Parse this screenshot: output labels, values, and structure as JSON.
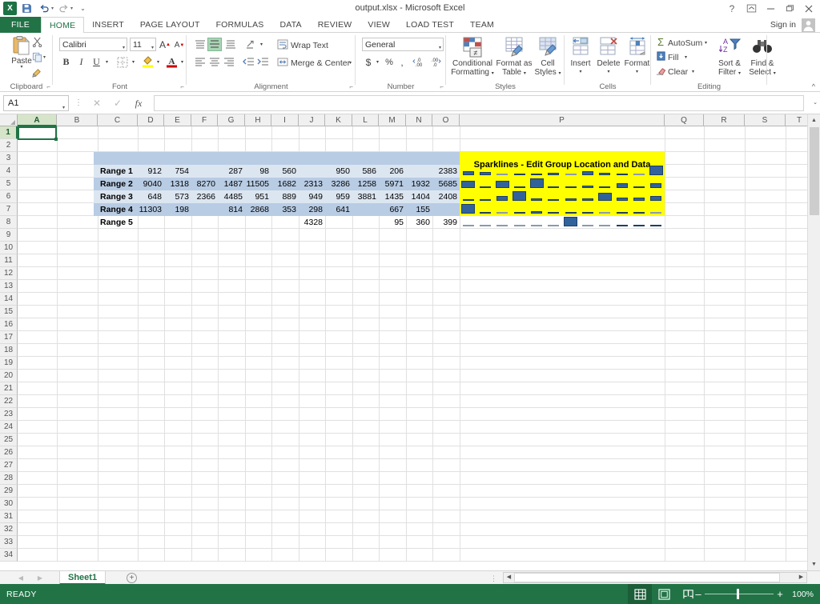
{
  "window": {
    "title": "output.xlsx - Microsoft Excel",
    "help_icon": "?",
    "ribbon_display_icon": "ribbon-options",
    "minimize_icon": "–",
    "restore_icon": "restore",
    "close_icon": "✕",
    "logo_text": "X"
  },
  "quick_access": [
    {
      "name": "save",
      "glyph": "💾"
    },
    {
      "name": "undo",
      "glyph": "↺"
    },
    {
      "name": "redo",
      "glyph": "↻"
    },
    {
      "name": "customize",
      "glyph": "⌄"
    }
  ],
  "tabs": [
    {
      "label": "FILE",
      "active": false,
      "file": true
    },
    {
      "label": "HOME",
      "active": true
    },
    {
      "label": "INSERT",
      "active": false
    },
    {
      "label": "PAGE LAYOUT",
      "active": false
    },
    {
      "label": "FORMULAS",
      "active": false
    },
    {
      "label": "DATA",
      "active": false
    },
    {
      "label": "REVIEW",
      "active": false
    },
    {
      "label": "VIEW",
      "active": false
    },
    {
      "label": "LOAD TEST",
      "active": false
    },
    {
      "label": "TEAM",
      "active": false
    }
  ],
  "account": {
    "signin_label": "Sign in"
  },
  "ribbon": {
    "groups": [
      {
        "name": "clipboard",
        "label": "Clipboard"
      },
      {
        "name": "font",
        "label": "Font"
      },
      {
        "name": "alignment",
        "label": "Alignment"
      },
      {
        "name": "number",
        "label": "Number"
      },
      {
        "name": "styles",
        "label": "Styles"
      },
      {
        "name": "cells",
        "label": "Cells"
      },
      {
        "name": "editing",
        "label": "Editing"
      }
    ],
    "clipboard": {
      "paste_label": "Paste",
      "cut": "Cut",
      "copy": "Copy",
      "format_painter": "Format Painter"
    },
    "font": {
      "font_name": "Calibri",
      "font_size": "11",
      "grow_font": "A",
      "shrink_font": "A",
      "bold": "B",
      "italic": "I",
      "underline": "U",
      "borders": "Borders",
      "fill_color": "Fill Color",
      "font_color": "Font Color"
    },
    "alignment": {
      "wrap_text": "Wrap Text",
      "merge_center": "Merge & Center",
      "orientation": "Orientation",
      "decrease_indent": "Decrease Indent",
      "increase_indent": "Increase Indent"
    },
    "number": {
      "format": "General",
      "accounting": "$",
      "percent": "%",
      "comma": ",",
      "increase_decimal": "Increase Decimal",
      "decrease_decimal": "Decrease Decimal"
    },
    "styles": {
      "conditional_formatting": "Conditional\nFormatting",
      "conditional_formatting_l1": "Conditional",
      "conditional_formatting_l2": "Formatting",
      "format_as_table_l1": "Format as",
      "format_as_table_l2": "Table",
      "cell_styles_l1": "Cell",
      "cell_styles_l2": "Styles"
    },
    "cells": {
      "insert": "Insert",
      "delete": "Delete",
      "format": "Format"
    },
    "editing": {
      "autosum": "AutoSum",
      "fill": "Fill",
      "clear": "Clear",
      "sort_filter_l1": "Sort &",
      "sort_filter_l2": "Filter",
      "find_select_l1": "Find &",
      "find_select_l2": "Select"
    },
    "collapse_icon": "^"
  },
  "formula_bar": {
    "name_box": "A1",
    "cancel_icon": "✕",
    "enter_icon": "✓",
    "fx_icon": "fx",
    "formula_value": "",
    "expand_icon": "⌄"
  },
  "grid": {
    "columns": [
      "A",
      "B",
      "C",
      "D",
      "E",
      "F",
      "G",
      "H",
      "I",
      "J",
      "K",
      "L",
      "M",
      "N",
      "O",
      "P",
      "Q",
      "R",
      "S",
      "T"
    ],
    "selected_column": "A",
    "rows": [
      1,
      2,
      3,
      4,
      5,
      6,
      7,
      8,
      9,
      10,
      11,
      12,
      13,
      14,
      15,
      16,
      17,
      18,
      19,
      20,
      21,
      22,
      23,
      24,
      25,
      26,
      27,
      28,
      29,
      30,
      31,
      32,
      33,
      34
    ],
    "selected_row": 1,
    "active_cell": "A1",
    "sparkline_title": "Sparklines - Edit Group Location and Data",
    "sparkline_fill_color": "#ffff00",
    "band_color_a": "#b8cce4",
    "band_color_b": "#dce6f1",
    "bar_color": "#31629b",
    "table": {
      "label_column": "C",
      "data_columns": [
        "D",
        "E",
        "F",
        "G",
        "H",
        "I",
        "J",
        "K",
        "L",
        "M",
        "N",
        "O"
      ],
      "rows": [
        {
          "row": 4,
          "label": "Range 1",
          "values": [
            "912",
            "754",
            "",
            "287",
            "98",
            "560",
            "",
            "950",
            "586",
            "206",
            "",
            "2383"
          ]
        },
        {
          "row": 5,
          "label": "Range 2",
          "values": [
            "9040",
            "1318",
            "8270",
            "1487",
            "11505",
            "1682",
            "2313",
            "3286",
            "1258",
            "5971",
            "1932",
            "5685"
          ]
        },
        {
          "row": 6,
          "label": "Range 3",
          "values": [
            "648",
            "573",
            "2366",
            "4485",
            "951",
            "889",
            "949",
            "959",
            "3881",
            "1435",
            "1404",
            "2408"
          ]
        },
        {
          "row": 7,
          "label": "Range 4",
          "values": [
            "11303",
            "198",
            "",
            "814",
            "2868",
            "353",
            "298",
            "641",
            "",
            "667",
            "155",
            ""
          ]
        },
        {
          "row": 8,
          "label": "Range 5",
          "values": [
            "",
            "",
            "",
            "",
            "",
            "",
            "4328",
            "",
            "",
            "95",
            "360",
            "399"
          ]
        }
      ]
    }
  },
  "chart_data": {
    "type": "bar",
    "title": "Sparklines - Edit Group Location and Data",
    "categories": [
      "D",
      "E",
      "F",
      "G",
      "H",
      "I",
      "J",
      "K",
      "L",
      "M",
      "N",
      "O"
    ],
    "series": [
      {
        "name": "Range 1",
        "values": [
          912,
          754,
          null,
          287,
          98,
          560,
          null,
          950,
          586,
          206,
          null,
          2383
        ]
      },
      {
        "name": "Range 2",
        "values": [
          9040,
          1318,
          8270,
          1487,
          11505,
          1682,
          2313,
          3286,
          1258,
          5971,
          1932,
          5685
        ]
      },
      {
        "name": "Range 3",
        "values": [
          648,
          573,
          2366,
          4485,
          951,
          889,
          949,
          959,
          3881,
          1435,
          1404,
          2408
        ]
      },
      {
        "name": "Range 4",
        "values": [
          11303,
          198,
          null,
          814,
          2868,
          353,
          298,
          641,
          null,
          667,
          155,
          null
        ]
      },
      {
        "name": "Range 5",
        "values": [
          null,
          null,
          null,
          null,
          null,
          null,
          4328,
          null,
          null,
          95,
          360,
          399
        ]
      }
    ],
    "xlabel": "",
    "ylabel": "",
    "legend": "none",
    "grid": false
  },
  "sheet_tabs": {
    "prev_icon": "◀",
    "next_icon": "▶",
    "sheets": [
      {
        "label": "Sheet1",
        "active": true
      }
    ],
    "add_sheet_icon": "+"
  },
  "status_bar": {
    "mode": "READY",
    "view_normal_icon": "normal-view",
    "view_layout_icon": "page-layout-view",
    "view_break_icon": "page-break-view",
    "zoom_out_icon": "–",
    "zoom_in_icon": "+",
    "zoom_level": "100%"
  }
}
